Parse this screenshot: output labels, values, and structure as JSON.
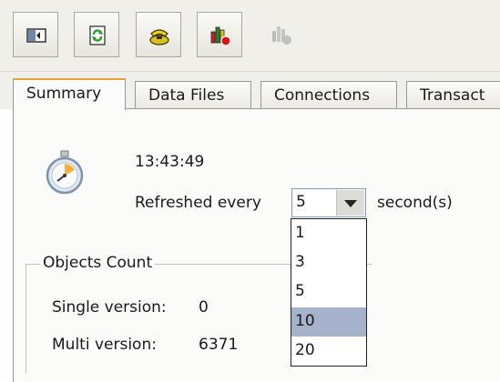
{
  "toolbar": {
    "buttons": [
      {
        "icon": "panel-toggle-icon"
      },
      {
        "icon": "refresh-page-icon"
      },
      {
        "icon": "phone-connect-icon"
      },
      {
        "icon": "chart-record-icon"
      },
      {
        "icon": "chart-disabled-icon"
      }
    ]
  },
  "tabs": [
    {
      "label": "Summary",
      "active": true
    },
    {
      "label": "Data Files",
      "active": false
    },
    {
      "label": "Connections",
      "active": false
    },
    {
      "label": "Transact",
      "active": false
    }
  ],
  "summary": {
    "time": "13:43:49",
    "refresh_label": "Refreshed every",
    "refresh_value": "5",
    "seconds_label": "second(s)",
    "refresh_options": [
      "1",
      "3",
      "5",
      "10",
      "20"
    ],
    "highlighted_option": "10"
  },
  "objects": {
    "title": "Objects Count",
    "single_label": "Single version:",
    "single_value": "0",
    "multi_label": "Multi version:",
    "multi_value": "6371"
  },
  "colors": {
    "active_tab_accent": "#e6a23c",
    "selection": "#a4b2cc"
  }
}
